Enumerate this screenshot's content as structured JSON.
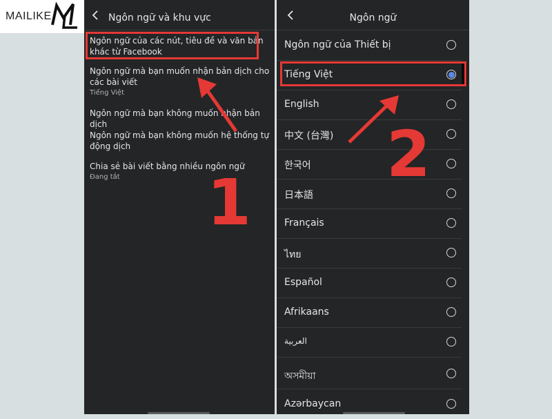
{
  "logo": {
    "text": "MAILIKE"
  },
  "left": {
    "header_title": "Ngôn ngữ và khu vực",
    "settings": [
      {
        "title": "Ngôn ngữ của các nút, tiêu đề và văn bản khác từ Facebook",
        "sub": ""
      },
      {
        "title": "Ngôn ngữ mà bạn muốn nhận bản dịch cho các bài viết",
        "sub": "Tiếng Việt"
      },
      {
        "title": "Ngôn ngữ mà bạn không muốn nhận bản dịch",
        "sub": ""
      },
      {
        "title": "Ngôn ngữ mà bạn không muốn hệ thống tự động dịch",
        "sub": ""
      },
      {
        "title": "Chia sẻ bài viết bằng nhiều ngôn ngữ",
        "sub": "Đang tắt"
      }
    ]
  },
  "right": {
    "header_title": "Ngôn ngữ",
    "languages": [
      {
        "label": "Ngôn ngữ của Thiết bị",
        "selected": false
      },
      {
        "label": "Tiếng Việt",
        "selected": true
      },
      {
        "label": "English",
        "selected": false
      },
      {
        "label": "中文 (台灣)",
        "selected": false
      },
      {
        "label": "한국어",
        "selected": false
      },
      {
        "label": "日本語",
        "selected": false
      },
      {
        "label": "Français",
        "selected": false
      },
      {
        "label": "ไทย",
        "selected": false
      },
      {
        "label": "Español",
        "selected": false
      },
      {
        "label": "Afrikaans",
        "selected": false
      },
      {
        "label": "العربية",
        "selected": false
      },
      {
        "label": "অসমীয়া",
        "selected": false
      },
      {
        "label": "Azərbaycan",
        "selected": false
      }
    ]
  },
  "annotations": {
    "step1": "1",
    "step2": "2"
  },
  "colors": {
    "highlight": "#e53935",
    "accent": "#5b87e9",
    "panel_bg": "#242526"
  }
}
